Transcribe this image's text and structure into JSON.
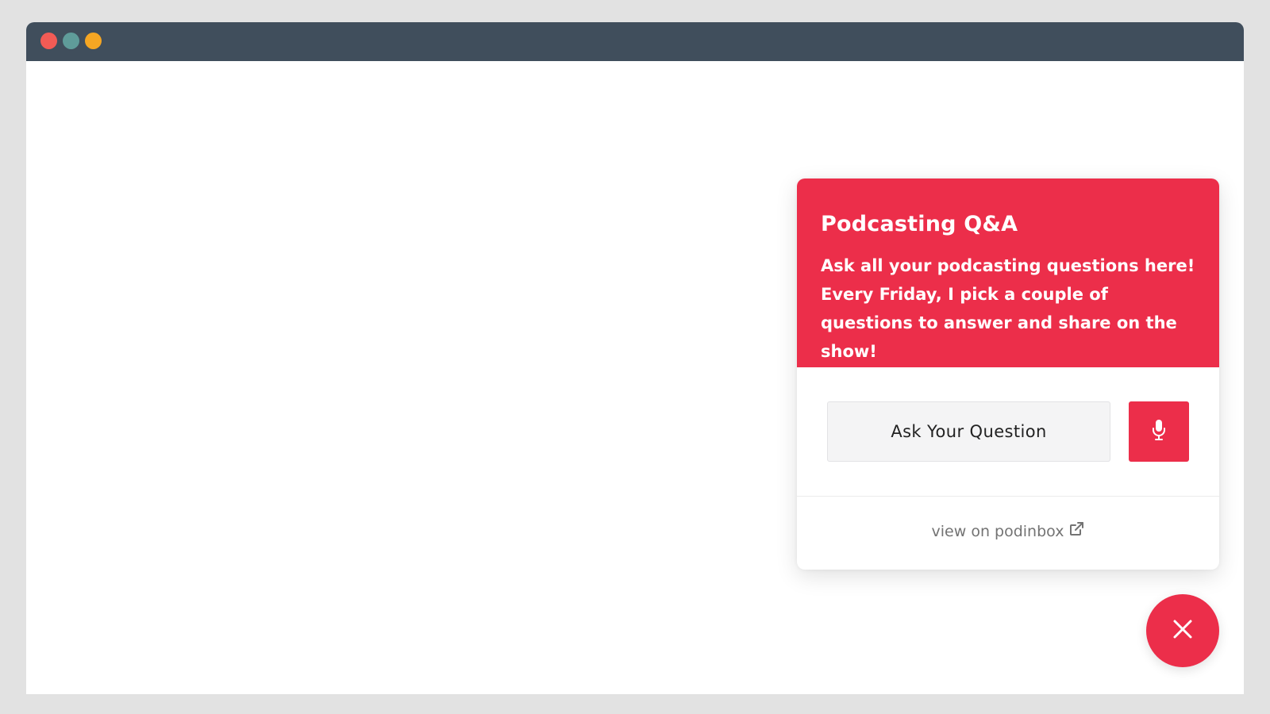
{
  "window": {
    "controls": [
      "close",
      "minimize",
      "maximize"
    ]
  },
  "widget": {
    "title": "Podcasting Q&A",
    "description": "Ask all your podcasting questions here! Every Friday, I pick a couple of questions to answer and share on the show!",
    "ask_button_label": "Ask Your Question",
    "mic_icon": "microphone-icon",
    "view_link_label": "view on podinbox",
    "view_link_icon": "external-link-icon",
    "accent_color": "#ec2e4a"
  },
  "fab": {
    "icon": "close-icon"
  }
}
